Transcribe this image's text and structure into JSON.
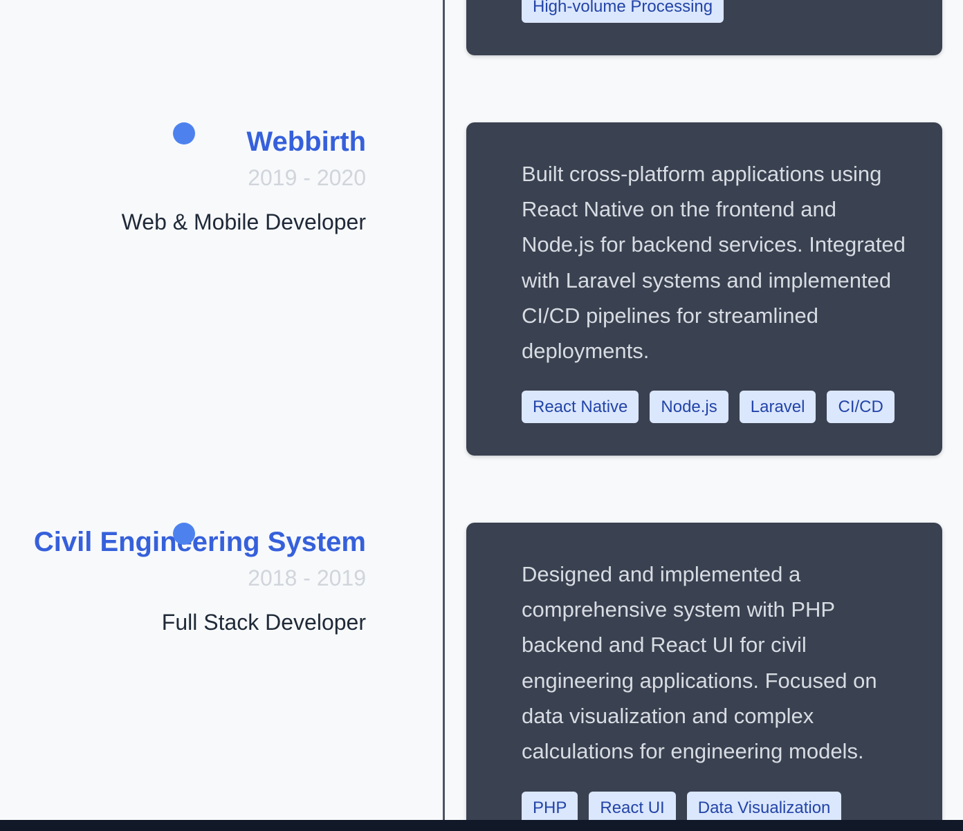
{
  "timeline": {
    "top_card": {
      "tags": [
        "High-volume Processing"
      ]
    },
    "entries": [
      {
        "company": "Webbirth",
        "dates": "2019 - 2020",
        "role": "Web & Mobile Developer",
        "description": "Built cross-platform applications using React Native on the frontend and Node.js for backend services. Integrated with Laravel systems and implemented CI/CD pipelines for streamlined deployments.",
        "tags": [
          "React Native",
          "Node.js",
          "Laravel",
          "CI/CD"
        ]
      },
      {
        "company": "Civil Engineering System",
        "dates": "2018 - 2019",
        "role": "Full Stack Developer",
        "description": "Designed and implemented a comprehensive system with PHP backend and React UI for civil engineering applications. Focused on data visualization and complex calculations for engineering models.",
        "tags": [
          "PHP",
          "React UI",
          "Data Visualization"
        ]
      }
    ]
  },
  "colors": {
    "accent": "#3660db",
    "dot": "#4d82ee",
    "card_bg": "#3a4150",
    "tag_bg": "#dbe7fc",
    "tag_text": "#2344a8",
    "timeline_line": "#4b5563"
  }
}
